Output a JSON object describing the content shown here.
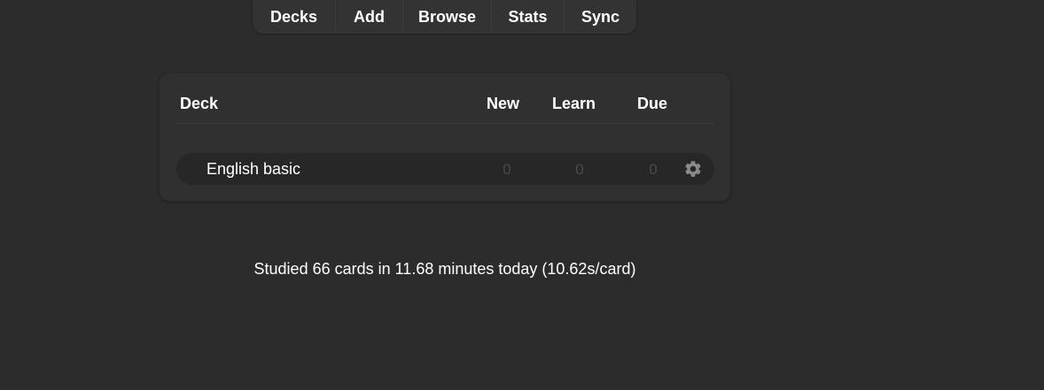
{
  "toolbar": {
    "items": [
      {
        "label": "Decks"
      },
      {
        "label": "Add"
      },
      {
        "label": "Browse"
      },
      {
        "label": "Stats"
      },
      {
        "label": "Sync"
      }
    ]
  },
  "deck_table": {
    "headers": {
      "deck": "Deck",
      "new": "New",
      "learn": "Learn",
      "due": "Due"
    },
    "rows": [
      {
        "name": "English basic",
        "new": "0",
        "learn": "0",
        "due": "0",
        "options_icon": "gear-icon"
      }
    ]
  },
  "footer": {
    "study_stats": "Studied 66 cards in 11.68 minutes today (10.62s/card)"
  },
  "colors": {
    "background": "#2c2c2c",
    "toolbar": "#333333",
    "card": "#303030",
    "row": "#272727",
    "zero_count": "#4a4a4a",
    "gear": "#8a8a8a"
  }
}
